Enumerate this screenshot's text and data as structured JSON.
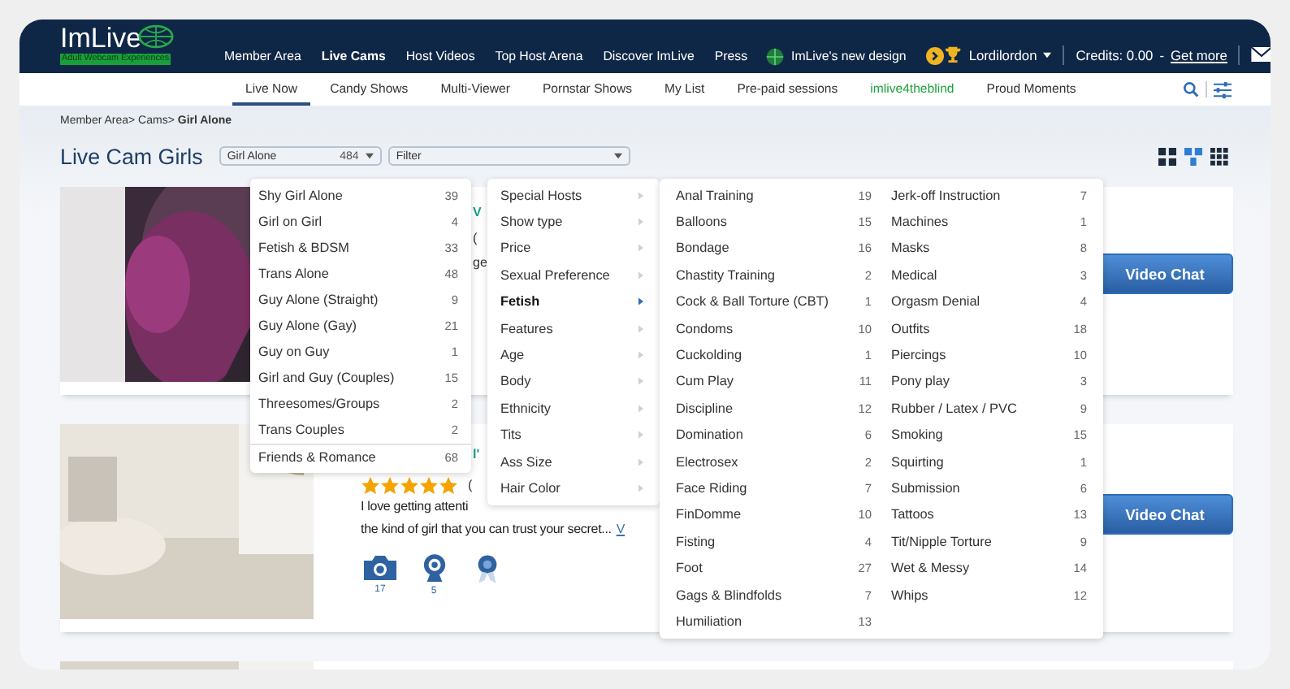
{
  "logo": {
    "name": "ImLive",
    "tagline": "Adult Webcam Experiences"
  },
  "nav": [
    {
      "label": "Member Area",
      "selected": false
    },
    {
      "label": "Live Cams",
      "selected": true
    },
    {
      "label": "Host Videos",
      "selected": false
    },
    {
      "label": "Top Host Arena",
      "selected": false
    },
    {
      "label": "Discover ImLive",
      "selected": false
    },
    {
      "label": "Press",
      "selected": false
    }
  ],
  "new_design": "ImLive's new design",
  "user": "Lordilordon",
  "credits": "Credits: 0.00",
  "dash": "-",
  "get_more": "Get more",
  "subnav": [
    {
      "label": "Live Now",
      "selected": true,
      "kind": "plain"
    },
    {
      "label": "Candy Shows",
      "selected": false,
      "kind": "plain"
    },
    {
      "label": "Multi-Viewer",
      "selected": false,
      "kind": "plain"
    },
    {
      "label": "Pornstar Shows",
      "selected": false,
      "kind": "plain"
    },
    {
      "label": "My List",
      "selected": false,
      "kind": "plain"
    },
    {
      "label": "Pre-paid sessions",
      "selected": false,
      "kind": "plain"
    },
    {
      "label": "imlive4theblind",
      "selected": false,
      "kind": "accent"
    },
    {
      "label": "Proud Moments",
      "selected": false,
      "kind": "plain"
    }
  ],
  "breadcrumb": "Member Area> Cams> **Girl Alone**",
  "page_title": "Live Cam Girls",
  "category_select": {
    "value": "Girl Alone",
    "count": "484"
  },
  "filter_select": {
    "value": "Filter"
  },
  "view_modes": [
    {
      "kind": "large-grid",
      "selected": false
    },
    {
      "kind": "list",
      "selected": true
    },
    {
      "kind": "small-grid",
      "selected": false
    }
  ],
  "category_menu": [
    {
      "label": "Shy Girl Alone",
      "count": "39",
      "divider_before": false
    },
    {
      "label": "Girl on Girl",
      "count": "4",
      "divider_before": false
    },
    {
      "label": "Fetish & BDSM",
      "count": "33",
      "divider_before": false
    },
    {
      "label": "Trans Alone",
      "count": "48",
      "divider_before": false
    },
    {
      "label": "Guy Alone (Straight)",
      "count": "9",
      "divider_before": false
    },
    {
      "label": "Guy Alone (Gay)",
      "count": "21",
      "divider_before": false
    },
    {
      "label": "Guy on Guy",
      "count": "1",
      "divider_before": false
    },
    {
      "label": "Girl and Guy (Couples)",
      "count": "15",
      "divider_before": false
    },
    {
      "label": "Threesomes/Groups",
      "count": "2",
      "divider_before": false
    },
    {
      "label": "Trans Couples",
      "count": "2",
      "divider_before": false
    },
    {
      "label": "Friends & Romance",
      "count": "68",
      "divider_before": true
    }
  ],
  "filter_menu": [
    {
      "label": "Special Hosts",
      "selected": false
    },
    {
      "label": "Show type",
      "selected": false
    },
    {
      "label": "Price",
      "selected": false
    },
    {
      "label": "Sexual Preference",
      "selected": false
    },
    {
      "label": "Fetish",
      "selected": true
    },
    {
      "label": "Features",
      "selected": false
    },
    {
      "label": "Age",
      "selected": false
    },
    {
      "label": "Body",
      "selected": false
    },
    {
      "label": "Ethnicity",
      "selected": false
    },
    {
      "label": "Tits",
      "selected": false
    },
    {
      "label": "Ass Size",
      "selected": false
    },
    {
      "label": "Hair Color",
      "selected": false
    }
  ],
  "fetish_menu": [
    [
      {
        "label": "Anal Training",
        "count": "19"
      },
      {
        "label": "Balloons",
        "count": "15"
      },
      {
        "label": "Bondage",
        "count": "16"
      },
      {
        "label": "Chastity Training",
        "count": "2"
      },
      {
        "label": "Cock & Ball Torture (CBT)",
        "count": "1"
      },
      {
        "label": "Condoms",
        "count": "10"
      },
      {
        "label": "Cuckolding",
        "count": "1"
      },
      {
        "label": "Cum Play",
        "count": "11"
      },
      {
        "label": "Discipline",
        "count": "12"
      },
      {
        "label": "Domination",
        "count": "6"
      },
      {
        "label": "Electrosex",
        "count": "2"
      },
      {
        "label": "Face Riding",
        "count": "7"
      },
      {
        "label": "FinDomme",
        "count": "10"
      },
      {
        "label": "Fisting",
        "count": "4"
      },
      {
        "label": "Foot",
        "count": "27"
      },
      {
        "label": "Gags & Blindfolds",
        "count": "7"
      },
      {
        "label": "Humiliation",
        "count": "13"
      }
    ],
    [
      {
        "label": "Jerk-off Instruction",
        "count": "7"
      },
      {
        "label": "Machines",
        "count": "1"
      },
      {
        "label": "Masks",
        "count": "8"
      },
      {
        "label": "Medical",
        "count": "3"
      },
      {
        "label": "Orgasm Denial",
        "count": "4"
      },
      {
        "label": "Outfits",
        "count": "18"
      },
      {
        "label": "Piercings",
        "count": "10"
      },
      {
        "label": "Pony play",
        "count": "3"
      },
      {
        "label": "Rubber / Latex / PVC",
        "count": "9"
      },
      {
        "label": "Smoking",
        "count": "15"
      },
      {
        "label": "Squirting",
        "count": "1"
      },
      {
        "label": "Submission",
        "count": "6"
      },
      {
        "label": "Tattoos",
        "count": "13"
      },
      {
        "label": "Tit/Nipple Torture",
        "count": "9"
      },
      {
        "label": "Wet & Messy",
        "count": "14"
      },
      {
        "label": "Whips",
        "count": "12"
      }
    ]
  ],
  "cards": [
    {
      "kind": "clipped",
      "fragments": [
        "V",
        "(",
        "ge"
      ],
      "button": "Video Chat"
    },
    {
      "kind": "full",
      "name": "l'",
      "stars": 5,
      "rating": "(",
      "description": [
        "I love getting attenti",
        "the kind of girl that you can trust your secret..."
      ],
      "more_link": "V",
      "badges": [
        {
          "kind": "camera",
          "count": "17"
        },
        {
          "kind": "webcam",
          "count": "5"
        },
        {
          "kind": "award"
        }
      ],
      "button": "Video Chat"
    },
    {
      "kind": "image-only"
    }
  ]
}
